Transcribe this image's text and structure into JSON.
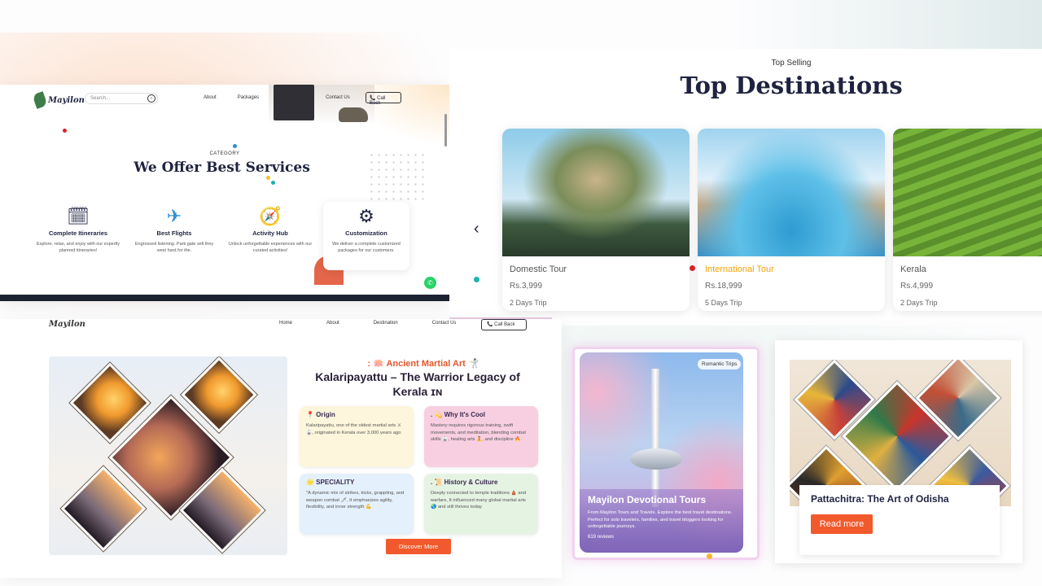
{
  "services_page": {
    "logo_text": "Mayilon",
    "search_placeholder": "Search...",
    "search_icon": "search-icon",
    "nav": [
      "About",
      "Packages",
      "Destination",
      "Contact Us"
    ],
    "call_back": "📞 Call Back",
    "category": "CATEGORY",
    "title": "We Offer Best Services",
    "services": [
      {
        "icon": "🗓",
        "title": "Complete Itineraries",
        "desc": "Explore, relax, and enjoy with our expertly planned itineraries!"
      },
      {
        "icon": "✈",
        "title": "Best Flights",
        "desc": "Engrossed listening. Park gate sell they west hard for the."
      },
      {
        "icon": "🧭",
        "title": "Activity Hub",
        "desc": "Unlock unforgettable experiences with our curated activities!"
      },
      {
        "icon": "⚙",
        "title": "Customization",
        "desc": "We deliver a complete customized packages for our customers."
      }
    ],
    "whatsapp_icon": "whatsapp-icon"
  },
  "destinations": {
    "subtitle": "Top Selling",
    "title": "Top Destinations",
    "prev": "‹",
    "cards": [
      {
        "name": "Domestic Tour",
        "price": "Rs.3,999",
        "duration": "2 Days Trip",
        "name_color": "#555555"
      },
      {
        "name": "International Tour",
        "price": "Rs.18,999",
        "duration": "5 Days Trip",
        "name_color": "#f2a40e"
      },
      {
        "name": "Kerala",
        "price": "Rs.4,999",
        "duration": "2 Days Trip",
        "name_color": "#555555"
      }
    ]
  },
  "kalari": {
    "nav_logo": "Mayilon",
    "nav": [
      "Home",
      "About",
      "Destination",
      "Contact Us"
    ],
    "call_back": "📞 Call Back",
    "kicker": ": 🪷 Ancient Martial Art 🤺",
    "title": "Kalaripayattu – The Warrior Legacy of Kerala ɪɴ",
    "boxes": [
      {
        "heading": "📍 Origin",
        "text": "Kalaripayattu, one of the oldest martial arts ⚔ 🥋, originated in Kerala over 3,000 years ago"
      },
      {
        "heading": ". 💫 Why It's Cool",
        "text": "Mastery requires rigorous training, swift movements, and meditation, blending combat skills 🥋, healing arts 🧘, and discipline 🔥."
      },
      {
        "heading": "🌟 SPECIALITY",
        "text": "\"A dynamic mix of strikes, kicks, grappling, and weapon combat 🗡, It emphasizes agility, flexibility, and inner strength 💪"
      },
      {
        "heading": ". 📜 History & Culture",
        "text": "Deeply connected to temple traditions 🛕 and warfare, It influenced many global martial arts 🌏 and still thrives today"
      }
    ],
    "discover": "Discover More"
  },
  "devotional": {
    "tag": "Romantic Trips",
    "title": "Mayilon Devotional Tours",
    "desc": "From Mayilon Tours and Travels. Explore the best travel destinations. Perfect for solo travelers, families, and travel bloggers looking for unforgettable journeys.",
    "reviews": "619 reviews"
  },
  "pattachitra": {
    "title": "Pattachitra: The Art of Odisha",
    "read_more": "Read more"
  },
  "colors": {
    "accent": "#f2592c",
    "navy": "#1f2340"
  }
}
